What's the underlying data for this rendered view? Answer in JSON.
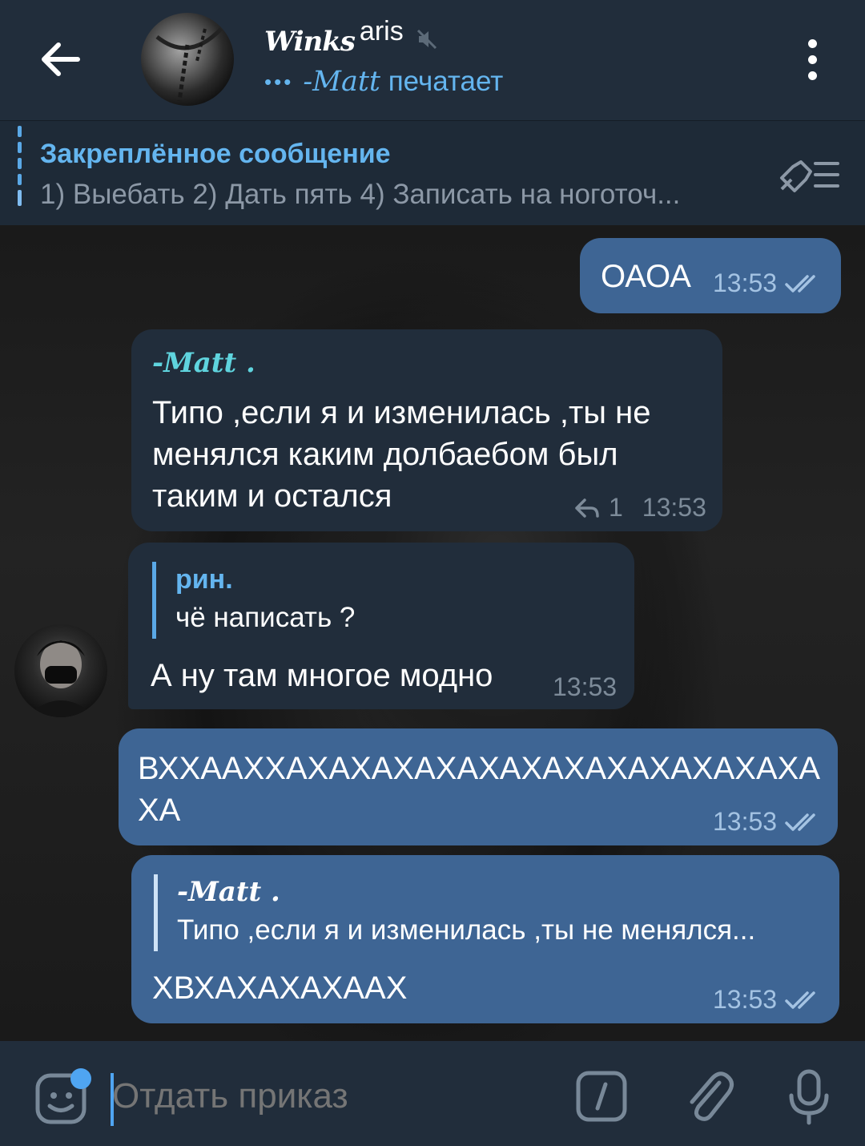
{
  "header": {
    "title_script": "Winks",
    "title_rest": "aris",
    "status_dots": "•••",
    "status_name": "-Matt",
    "status_action": "печатает"
  },
  "pinned": {
    "title": "Закреплённое сообщение",
    "text": "1) Выебать 2) Дать пять 4) Записать на ноготоч..."
  },
  "messages": [
    {
      "text": "ОАОА",
      "time": "13:53"
    },
    {
      "sender": "-Matt .",
      "text": "Типо ,если я и изменилась ,ты не\nменялся каким долбаебом был\nтаким и остался",
      "replies": "1",
      "time": "13:53"
    },
    {
      "reply_name": "рин.",
      "reply_text": "чё написать ?",
      "text": "А ну там многое модно",
      "time": "13:53"
    },
    {
      "text": "ВХХААХХАХАХАХАХАХАХАХАХАХАХАХАХА\nХА",
      "time": "13:53"
    },
    {
      "reply_name": "-Matt .",
      "reply_text": "Типо ,если я и изменилась ,ты не менялся...",
      "text": "ХВХАХАХАХААХ",
      "time": "13:53"
    }
  ],
  "input": {
    "placeholder": "Отдать приказ"
  },
  "colors": {
    "accent": "#64b5ef",
    "outgoing_bubble": "#3e6594",
    "incoming_bubble": "#212d3b",
    "header": "#212d3b"
  },
  "icons": [
    "back-arrow-icon",
    "mute-icon",
    "more-vertical-icon",
    "pin-list-icon",
    "reply-arrow-icon",
    "double-check-icon",
    "sticker-icon",
    "bot-command-icon",
    "attach-icon",
    "microphone-icon"
  ]
}
